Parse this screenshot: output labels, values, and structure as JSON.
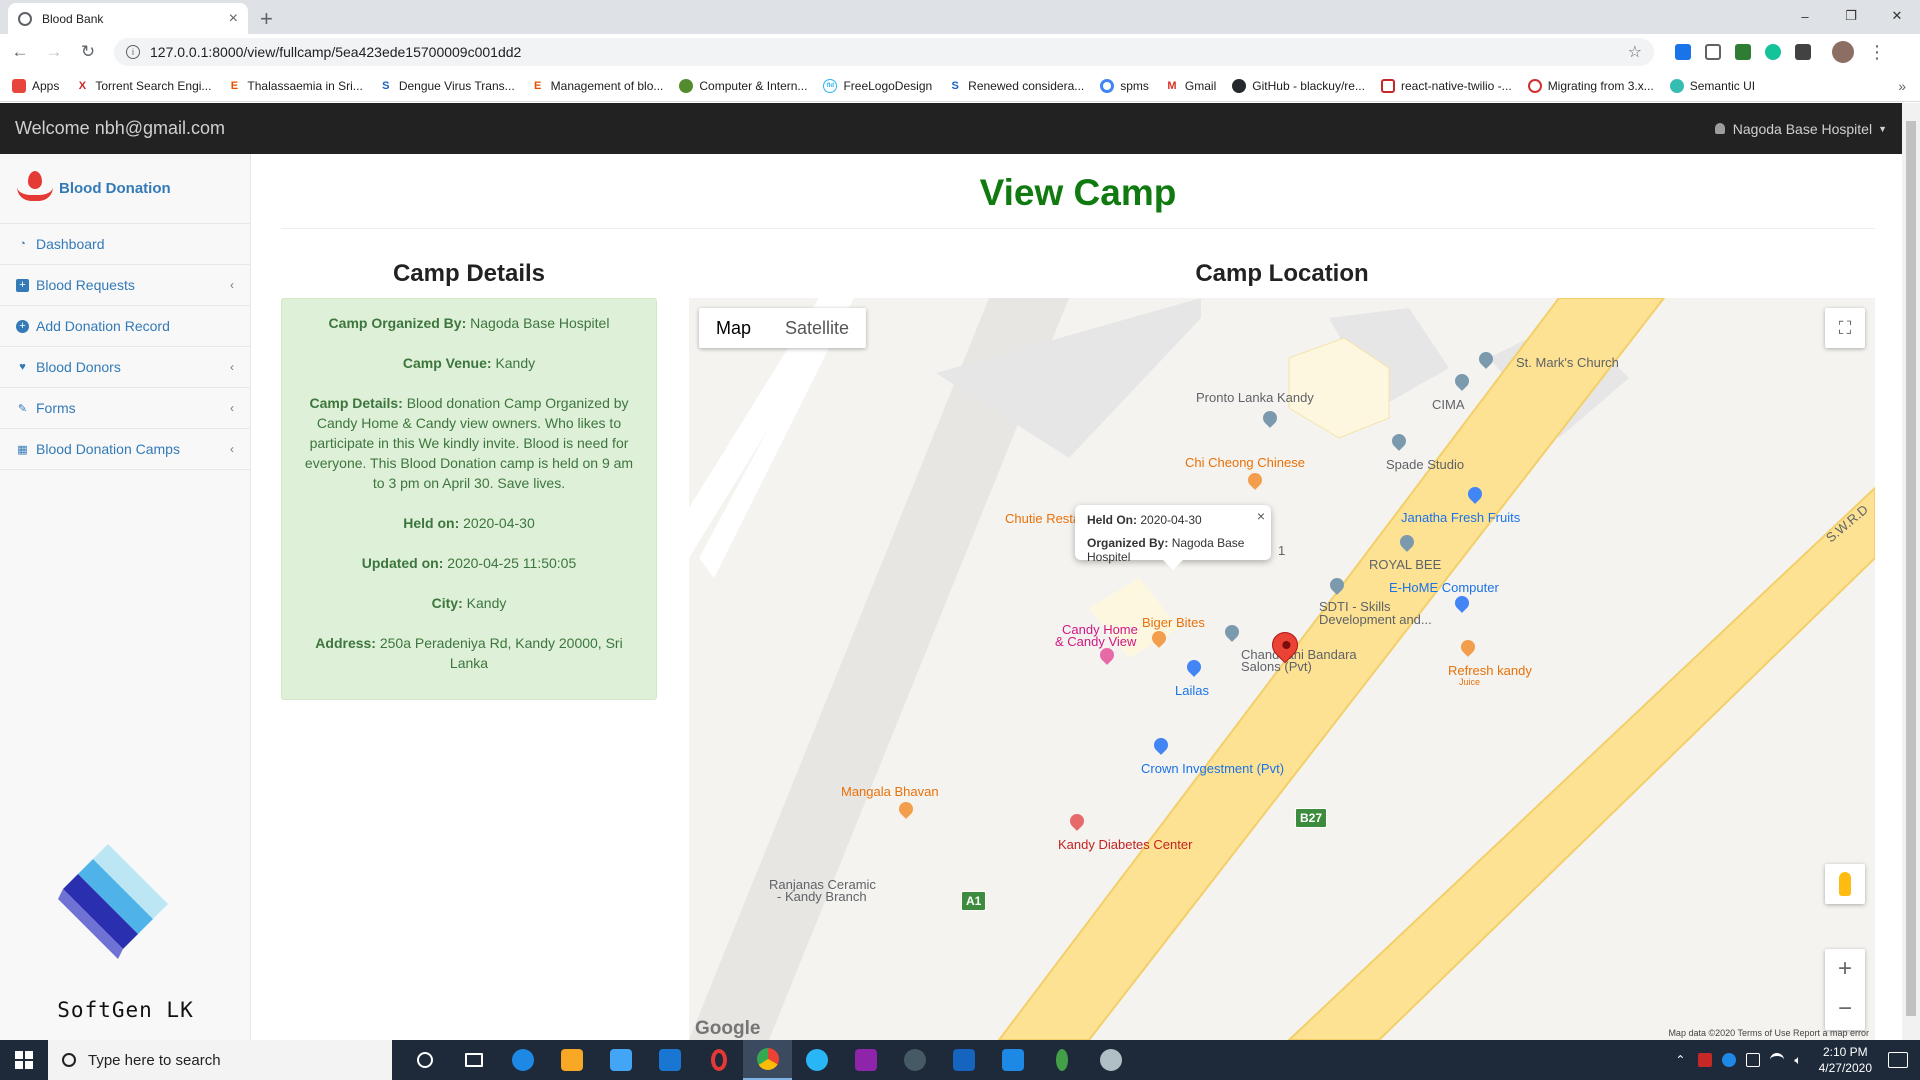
{
  "browser": {
    "tab_title": "Blood Bank",
    "url": "127.0.0.1:8000/view/fullcamp/5ea423ede15700009c001dd2",
    "window_minimize": "–",
    "window_maximize": "❐",
    "window_close": "✕",
    "bookmarks": [
      {
        "label": "Apps",
        "icon": "apps-grid-icon",
        "color": "#e8453c"
      },
      {
        "label": "Torrent Search Engi...",
        "icon": "x-icon",
        "color": "#c62828"
      },
      {
        "label": "Thalassaemia in Sri...",
        "icon": "e-icon",
        "color": "#e65100"
      },
      {
        "label": "Dengue Virus Trans...",
        "icon": "link-icon",
        "color": "#1565c0"
      },
      {
        "label": "Management of blo...",
        "icon": "e-icon",
        "color": "#e65100"
      },
      {
        "label": "Computer & Intern...",
        "icon": "leaf-icon",
        "color": "#558b2f"
      },
      {
        "label": "FreeLogoDesign",
        "icon": "fld-icon",
        "color": "#29b6f6"
      },
      {
        "label": "Renewed considera...",
        "icon": "link-icon",
        "color": "#1565c0"
      },
      {
        "label": "spms",
        "icon": "google-icon",
        "color": "#4285f4"
      },
      {
        "label": "Gmail",
        "icon": "gmail-icon",
        "color": "#d93025"
      },
      {
        "label": "GitHub - blackuy/re...",
        "icon": "github-icon",
        "color": "#24292e"
      },
      {
        "label": "react-native-twilio -...",
        "icon": "twilio-icon",
        "color": "#c62828"
      },
      {
        "label": "Migrating from 3.x...",
        "icon": "target-icon",
        "color": "#d32f2f"
      },
      {
        "label": "Semantic UI",
        "icon": "semantic-icon",
        "color": "#35bdb2"
      }
    ]
  },
  "navbar": {
    "welcome": "Welcome nbh@gmail.com",
    "user": "Nagoda Base Hospitel"
  },
  "sidebar": {
    "brand": "Blood Donation",
    "items": [
      {
        "label": "Dashboard",
        "icon": "dashboard-icon",
        "glyph": "◔",
        "has_arrow": false
      },
      {
        "label": "Blood Requests",
        "icon": "plus-square-icon",
        "glyph": "+",
        "has_arrow": true
      },
      {
        "label": "Add Donation Record",
        "icon": "plus-circle-icon",
        "glyph": "⊕",
        "has_arrow": false
      },
      {
        "label": "Blood Donors",
        "icon": "heartbeat-icon",
        "glyph": "♥",
        "has_arrow": true
      },
      {
        "label": "Forms",
        "icon": "edit-icon",
        "glyph": "✎",
        "has_arrow": true
      },
      {
        "label": "Blood Donation Camps",
        "icon": "calendar-icon",
        "glyph": "▦",
        "has_arrow": true
      }
    ],
    "footer_logo_text": "SoftGen LK"
  },
  "main": {
    "title": "View Camp",
    "details_title": "Camp Details",
    "location_title": "Camp Location",
    "details": {
      "organized_by_label": "Camp Organized By:",
      "organized_by": "Nagoda Base Hospitel",
      "venue_label": "Camp Venue:",
      "venue": "Kandy",
      "details_label": "Camp Details:",
      "details": "Blood donation Camp Organized by Candy Home & Candy view owners. Who likes to participate in this We kindly invite. Blood is need for everyone. This Blood Donation camp is held on 9 am to 3 pm on April 30. Save lives.",
      "held_on_label": "Held on:",
      "held_on": "2020-04-30",
      "updated_on_label": "Updated on:",
      "updated_on": "2020-04-25 11:50:05",
      "city_label": "City:",
      "city": "Kandy",
      "address_label": "Address:",
      "address": "250a Peradeniya Rd, Kandy 20000, Sri Lanka"
    }
  },
  "map": {
    "map_button": "Map",
    "satellite_button": "Satellite",
    "zoom_in": "+",
    "zoom_out": "−",
    "popup": {
      "held_on_label": "Held On:",
      "held_on": "2020-04-30",
      "organized_by_label": "Organized By:",
      "organized_by": "Nagoda Base Hospitel"
    },
    "places": {
      "pronto": "Pronto Lanka Kandy",
      "chi_cheong": "Chi Cheong Chinese",
      "st_marks": "St. Mark's Church",
      "cima": "CIMA",
      "spade": "Spade Studio",
      "janatha": "Janatha Fresh Fruits",
      "royal_bee": "ROYAL BEE",
      "ehome": "E-HoME Computer",
      "sdti_1": "SDTI - Skills",
      "sdti_2": "Development and...",
      "chutie": "Chutie Restau",
      "candy_home_1": "Candy Home",
      "candy_home_2": "& Candy View",
      "biger_bites": "Biger Bites",
      "chandhani_1": "Chandhani Bandara",
      "chandhani_2": "Salons (Pvt)",
      "lailas": "Lailas",
      "refresh": "Refresh kandy",
      "refresh_sub": "Juice",
      "crown": "Crown Invgestment (Pvt)",
      "mangala": "Mangala Bhavan",
      "kandy_diabetes": "Kandy Diabetes Center",
      "ranjanas_1": "Ranjanas Ceramic",
      "ranjanas_2": "- Kandy Branch",
      "road_swrd": "S.W.R.D",
      "road_1": "1"
    },
    "badge_b27": "B27",
    "badge_a1": "A1",
    "google": "Google",
    "terms": "Map data ©2020   Terms of Use   Report a map error"
  },
  "taskbar": {
    "search_placeholder": "Type here to search",
    "time": "2:10 PM",
    "date": "4/27/2020",
    "apps": [
      {
        "name": "cortana-icon",
        "color": "#ffffff"
      },
      {
        "name": "task-view-icon",
        "color": "#ffffff"
      },
      {
        "name": "edge-icon",
        "color": "#1e88e5"
      },
      {
        "name": "file-explorer-icon",
        "color": "#f9a825"
      },
      {
        "name": "store-icon",
        "color": "#42a5f5"
      },
      {
        "name": "mail-icon",
        "color": "#1976d2"
      },
      {
        "name": "opera-icon",
        "color": "#e53935"
      },
      {
        "name": "chrome-icon",
        "color": "#4caf50"
      },
      {
        "name": "skype-icon",
        "color": "#29b6f6"
      },
      {
        "name": "winrar-icon",
        "color": "#8e24aa"
      },
      {
        "name": "fox-icon",
        "color": "#455a64"
      },
      {
        "name": "word-icon",
        "color": "#1565c0"
      },
      {
        "name": "vscode-icon",
        "color": "#1e88e5"
      },
      {
        "name": "mongodb-icon",
        "color": "#43a047"
      },
      {
        "name": "tool-icon",
        "color": "#b0bec5"
      }
    ]
  }
}
